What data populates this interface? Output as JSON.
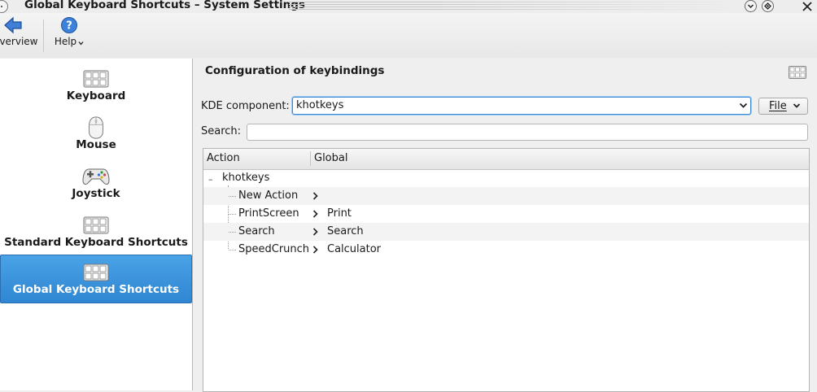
{
  "window": {
    "title": "Global Keyboard Shortcuts – System Settings"
  },
  "toolbar": {
    "overview_label": "Overview",
    "help_label": "Help"
  },
  "sidebar": {
    "items": [
      {
        "label": "Keyboard",
        "icon": "keyboard-icon",
        "selected": false
      },
      {
        "label": "Mouse",
        "icon": "mouse-icon",
        "selected": false
      },
      {
        "label": "Joystick",
        "icon": "joystick-icon",
        "selected": false
      },
      {
        "label": "Standard Keyboard Shortcuts",
        "icon": "keyboard-icon",
        "selected": false
      },
      {
        "label": "Global Keyboard Shortcuts",
        "icon": "keyboard-icon",
        "selected": true
      }
    ]
  },
  "main": {
    "title": "Configuration of keybindings",
    "kde_component_label": "KDE component:",
    "kde_component_value": "khotkeys",
    "file_button_label": "File",
    "search_label": "Search:",
    "search_value": "",
    "table": {
      "columns": [
        "Action",
        "Global"
      ],
      "group": {
        "label": "khotkeys",
        "expander": "–"
      },
      "rows": [
        {
          "action": "New Action",
          "global": ""
        },
        {
          "action": "PrintScreen",
          "global": "Print"
        },
        {
          "action": "Search",
          "global": "Search"
        },
        {
          "action": "SpeedCrunch",
          "global": "Calculator"
        }
      ]
    }
  },
  "colors": {
    "selection": "#3a92dc",
    "focus_border": "#3b8bd4"
  }
}
